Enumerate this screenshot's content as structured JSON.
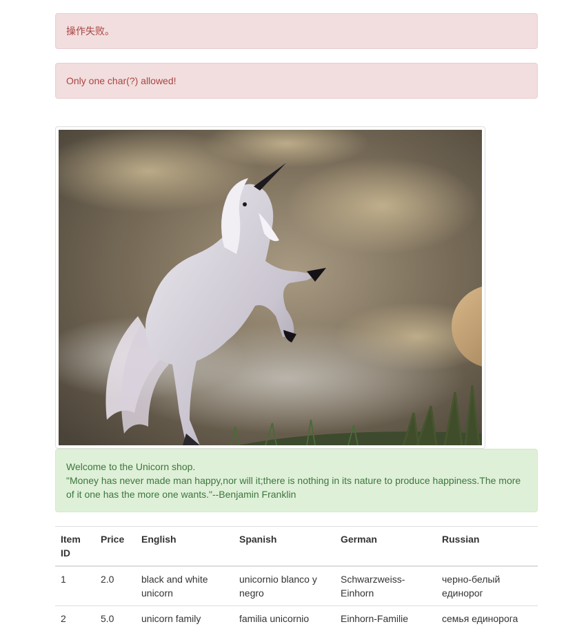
{
  "alerts": {
    "error_1": "操作失败。",
    "error_2": "Only one char(?) allowed!"
  },
  "image": {
    "subject": "white unicorn rearing under a cloudy sky"
  },
  "welcome": {
    "line_1": "Welcome to the Unicorn shop.",
    "line_2": "\"Money has never made man happy,nor will it;there is nothing in its nature to produce happiness.The more of it one has the more one wants.\"--Benjamin Franklin"
  },
  "table": {
    "headers": [
      "Item ID",
      "Price",
      "English",
      "Spanish",
      "German",
      "Russian"
    ],
    "rows": [
      [
        "1",
        "2.0",
        "black and white unicorn",
        "unicornio blanco y negro",
        "Schwarzweiss-Einhorn",
        "черно-белый единорог"
      ],
      [
        "2",
        "5.0",
        "unicorn family",
        "familia unicornio",
        "Einhorn-Familie",
        "семья единорога"
      ]
    ]
  },
  "colors": {
    "danger_bg": "#f2dede",
    "danger_text": "#a94442",
    "success_bg": "#dff0d8",
    "success_text": "#3c763d"
  }
}
